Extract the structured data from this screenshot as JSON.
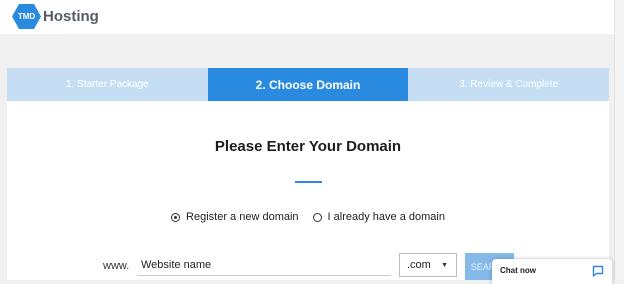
{
  "brand": {
    "badge": "TMD",
    "name": "Hosting",
    "color": "#2a8ae0"
  },
  "steps": [
    {
      "label": "1. Starter Package",
      "state": "completed"
    },
    {
      "label": "2. Choose Domain",
      "state": "active"
    },
    {
      "label": "3. Review & Complete",
      "state": "upcoming"
    }
  ],
  "main": {
    "title": "Please Enter Your Domain",
    "radio_options": [
      {
        "label": "Register a new domain",
        "selected": true
      },
      {
        "label": "I already have a domain",
        "selected": false
      }
    ],
    "www_prefix": "www.",
    "domain_input": {
      "value": "Website name"
    },
    "tld_select": {
      "selected": ".com"
    },
    "search_button": "SEARCH"
  },
  "chat": {
    "label": "Chat now",
    "icon": "chat-bubble-icon"
  },
  "colors": {
    "accent": "#2a8ae0",
    "step_inactive": "#c5def4",
    "background": "#f0f0f0"
  }
}
